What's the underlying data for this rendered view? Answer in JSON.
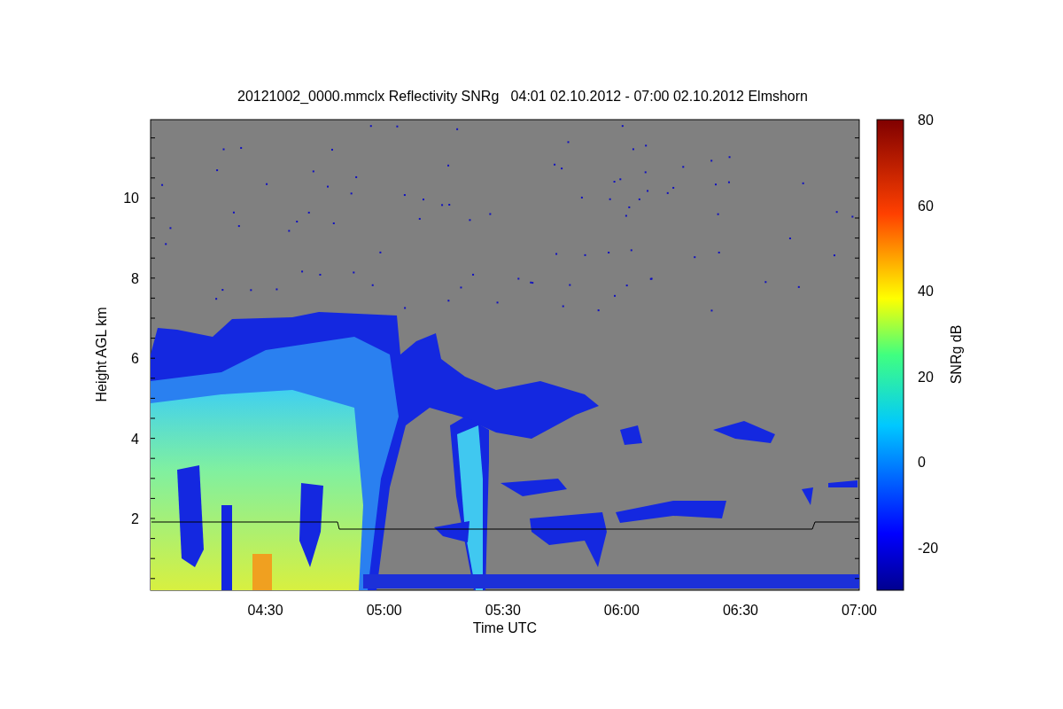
{
  "title": "20121002_0000.mmclx Reflectivity SNRg   04:01 02.10.2012 - 07:00 02.10.2012 Elmshorn",
  "y_axis": {
    "label": "Height AGL km",
    "ticks": [
      "10",
      "8",
      "6",
      "4",
      "2"
    ]
  },
  "x_axis": {
    "label": "Time UTC",
    "ticks": [
      "04:30",
      "05:00",
      "05:30",
      "06:00",
      "06:30",
      "07:00"
    ]
  },
  "colorbar": {
    "label": "SNRg dB",
    "ticks": [
      "80",
      "60",
      "40",
      "20",
      "0",
      "-20"
    ]
  }
}
